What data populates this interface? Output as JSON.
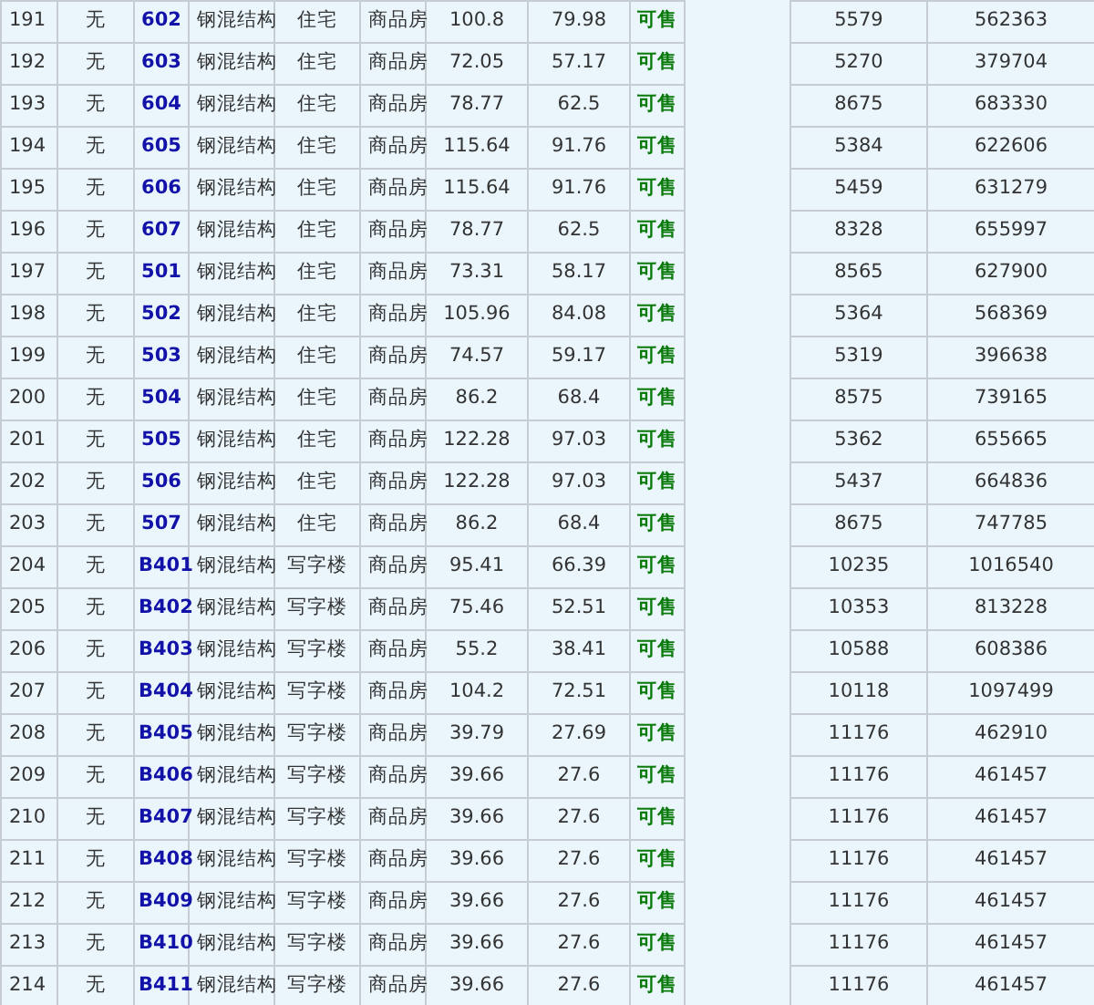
{
  "table": {
    "rows": [
      {
        "column_1": "191",
        "column_2": "无",
        "column_3": "602",
        "column_4": "钢混结构",
        "column_5": "住宅",
        "column_6": "商品房",
        "column_7": "100.8",
        "column_8": "79.98",
        "column_9": "可售",
        "column_10": "5579",
        "column_11": "562363"
      },
      {
        "column_1": "192",
        "column_2": "无",
        "column_3": "603",
        "column_4": "钢混结构",
        "column_5": "住宅",
        "column_6": "商品房",
        "column_7": "72.05",
        "column_8": "57.17",
        "column_9": "可售",
        "column_10": "5270",
        "column_11": "379704"
      },
      {
        "column_1": "193",
        "column_2": "无",
        "column_3": "604",
        "column_4": "钢混结构",
        "column_5": "住宅",
        "column_6": "商品房",
        "column_7": "78.77",
        "column_8": "62.5",
        "column_9": "可售",
        "column_10": "8675",
        "column_11": "683330"
      },
      {
        "column_1": "194",
        "column_2": "无",
        "column_3": "605",
        "column_4": "钢混结构",
        "column_5": "住宅",
        "column_6": "商品房",
        "column_7": "115.64",
        "column_8": "91.76",
        "column_9": "可售",
        "column_10": "5384",
        "column_11": "622606"
      },
      {
        "column_1": "195",
        "column_2": "无",
        "column_3": "606",
        "column_4": "钢混结构",
        "column_5": "住宅",
        "column_6": "商品房",
        "column_7": "115.64",
        "column_8": "91.76",
        "column_9": "可售",
        "column_10": "5459",
        "column_11": "631279"
      },
      {
        "column_1": "196",
        "column_2": "无",
        "column_3": "607",
        "column_4": "钢混结构",
        "column_5": "住宅",
        "column_6": "商品房",
        "column_7": "78.77",
        "column_8": "62.5",
        "column_9": "可售",
        "column_10": "8328",
        "column_11": "655997"
      },
      {
        "column_1": "197",
        "column_2": "无",
        "column_3": "501",
        "column_4": "钢混结构",
        "column_5": "住宅",
        "column_6": "商品房",
        "column_7": "73.31",
        "column_8": "58.17",
        "column_9": "可售",
        "column_10": "8565",
        "column_11": "627900"
      },
      {
        "column_1": "198",
        "column_2": "无",
        "column_3": "502",
        "column_4": "钢混结构",
        "column_5": "住宅",
        "column_6": "商品房",
        "column_7": "105.96",
        "column_8": "84.08",
        "column_9": "可售",
        "column_10": "5364",
        "column_11": "568369"
      },
      {
        "column_1": "199",
        "column_2": "无",
        "column_3": "503",
        "column_4": "钢混结构",
        "column_5": "住宅",
        "column_6": "商品房",
        "column_7": "74.57",
        "column_8": "59.17",
        "column_9": "可售",
        "column_10": "5319",
        "column_11": "396638"
      },
      {
        "column_1": "200",
        "column_2": "无",
        "column_3": "504",
        "column_4": "钢混结构",
        "column_5": "住宅",
        "column_6": "商品房",
        "column_7": "86.2",
        "column_8": "68.4",
        "column_9": "可售",
        "column_10": "8575",
        "column_11": "739165"
      },
      {
        "column_1": "201",
        "column_2": "无",
        "column_3": "505",
        "column_4": "钢混结构",
        "column_5": "住宅",
        "column_6": "商品房",
        "column_7": "122.28",
        "column_8": "97.03",
        "column_9": "可售",
        "column_10": "5362",
        "column_11": "655665"
      },
      {
        "column_1": "202",
        "column_2": "无",
        "column_3": "506",
        "column_4": "钢混结构",
        "column_5": "住宅",
        "column_6": "商品房",
        "column_7": "122.28",
        "column_8": "97.03",
        "column_9": "可售",
        "column_10": "5437",
        "column_11": "664836"
      },
      {
        "column_1": "203",
        "column_2": "无",
        "column_3": "507",
        "column_4": "钢混结构",
        "column_5": "住宅",
        "column_6": "商品房",
        "column_7": "86.2",
        "column_8": "68.4",
        "column_9": "可售",
        "column_10": "8675",
        "column_11": "747785"
      },
      {
        "column_1": "204",
        "column_2": "无",
        "column_3": "B401",
        "column_4": "钢混结构",
        "column_5": "写字楼",
        "column_6": "商品房",
        "column_7": "95.41",
        "column_8": "66.39",
        "column_9": "可售",
        "column_10": "10235",
        "column_11": "1016540"
      },
      {
        "column_1": "205",
        "column_2": "无",
        "column_3": "B402",
        "column_4": "钢混结构",
        "column_5": "写字楼",
        "column_6": "商品房",
        "column_7": "75.46",
        "column_8": "52.51",
        "column_9": "可售",
        "column_10": "10353",
        "column_11": "813228"
      },
      {
        "column_1": "206",
        "column_2": "无",
        "column_3": "B403",
        "column_4": "钢混结构",
        "column_5": "写字楼",
        "column_6": "商品房",
        "column_7": "55.2",
        "column_8": "38.41",
        "column_9": "可售",
        "column_10": "10588",
        "column_11": "608386"
      },
      {
        "column_1": "207",
        "column_2": "无",
        "column_3": "B404",
        "column_4": "钢混结构",
        "column_5": "写字楼",
        "column_6": "商品房",
        "column_7": "104.2",
        "column_8": "72.51",
        "column_9": "可售",
        "column_10": "10118",
        "column_11": "1097499"
      },
      {
        "column_1": "208",
        "column_2": "无",
        "column_3": "B405",
        "column_4": "钢混结构",
        "column_5": "写字楼",
        "column_6": "商品房",
        "column_7": "39.79",
        "column_8": "27.69",
        "column_9": "可售",
        "column_10": "11176",
        "column_11": "462910"
      },
      {
        "column_1": "209",
        "column_2": "无",
        "column_3": "B406",
        "column_4": "钢混结构",
        "column_5": "写字楼",
        "column_6": "商品房",
        "column_7": "39.66",
        "column_8": "27.6",
        "column_9": "可售",
        "column_10": "11176",
        "column_11": "461457"
      },
      {
        "column_1": "210",
        "column_2": "无",
        "column_3": "B407",
        "column_4": "钢混结构",
        "column_5": "写字楼",
        "column_6": "商品房",
        "column_7": "39.66",
        "column_8": "27.6",
        "column_9": "可售",
        "column_10": "11176",
        "column_11": "461457"
      },
      {
        "column_1": "211",
        "column_2": "无",
        "column_3": "B408",
        "column_4": "钢混结构",
        "column_5": "写字楼",
        "column_6": "商品房",
        "column_7": "39.66",
        "column_8": "27.6",
        "column_9": "可售",
        "column_10": "11176",
        "column_11": "461457"
      },
      {
        "column_1": "212",
        "column_2": "无",
        "column_3": "B409",
        "column_4": "钢混结构",
        "column_5": "写字楼",
        "column_6": "商品房",
        "column_7": "39.66",
        "column_8": "27.6",
        "column_9": "可售",
        "column_10": "11176",
        "column_11": "461457"
      },
      {
        "column_1": "213",
        "column_2": "无",
        "column_3": "B410",
        "column_4": "钢混结构",
        "column_5": "写字楼",
        "column_6": "商品房",
        "column_7": "39.66",
        "column_8": "27.6",
        "column_9": "可售",
        "column_10": "11176",
        "column_11": "461457"
      },
      {
        "column_1": "214",
        "column_2": "无",
        "column_3": "B411",
        "column_4": "钢混结构",
        "column_5": "写字楼",
        "column_6": "商品房",
        "column_7": "39.66",
        "column_8": "27.6",
        "column_9": "可售",
        "column_10": "11176",
        "column_11": "461457"
      }
    ]
  }
}
